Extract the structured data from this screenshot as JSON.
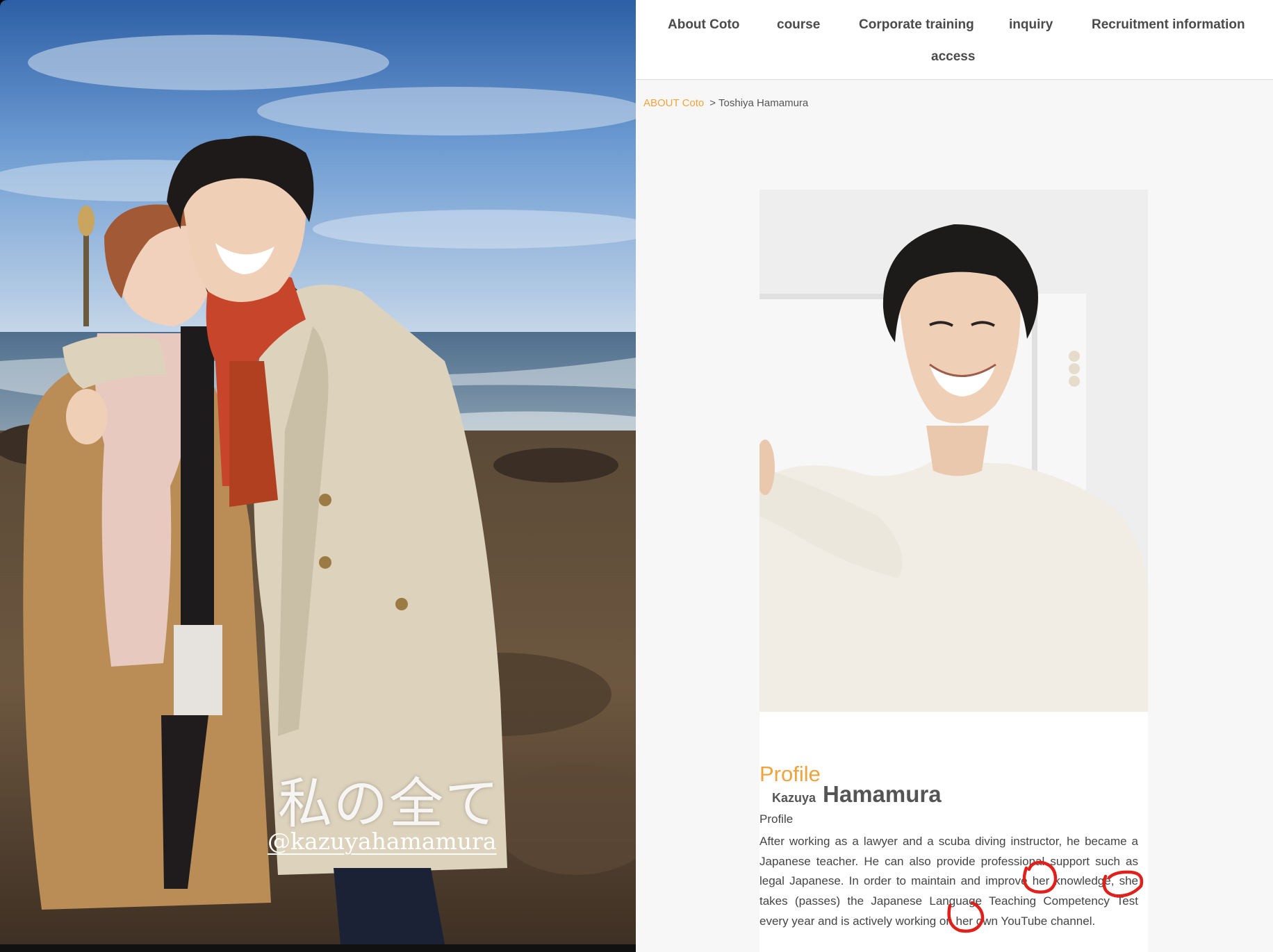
{
  "story": {
    "caption": "私の全て",
    "handle": "@kazuyahamamura"
  },
  "site": {
    "nav": {
      "items": [
        "About Coto",
        "course",
        "Corporate training",
        "inquiry",
        "Recruitment information",
        "access"
      ]
    },
    "breadcrumb": {
      "parent": "ABOUT Coto",
      "separator": ">",
      "current": "Toshiya Hamamura"
    },
    "profile": {
      "heading": "Profile",
      "first_name": "Kazuya",
      "last_name": "Hamamura",
      "sub_label": "Profile",
      "bio": "After working as a lawyer and a scuba diving instructor, he became a Japanese teacher. He can also provide professional support such as legal Japanese. In order to maintain and improve her knowledge, she takes (passes) the Japanese Language Teaching Competency Test every year and is actively working on her own YouTube channel."
    },
    "annotations": {
      "circle_color": "#e0201b",
      "circled_words": [
        "her",
        "she",
        "her"
      ]
    },
    "colors": {
      "accent": "#f0a33c",
      "nav_text": "#4a4a4a"
    }
  }
}
